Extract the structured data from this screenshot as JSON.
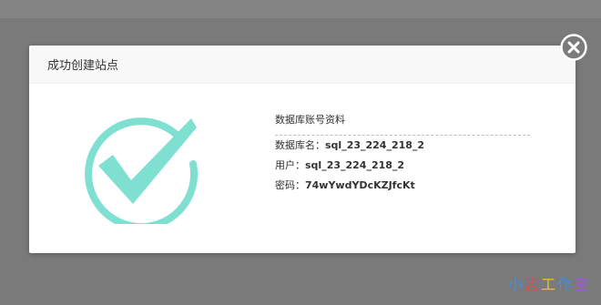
{
  "dialog": {
    "title": "成功创建站点",
    "close_icon": "close-circle-icon",
    "success_icon": "check-circle-icon",
    "colors": {
      "success": "#7fe0d1",
      "overlay": "#7a7a7a",
      "header_bg": "#f8f8f8",
      "close_bg": "#7b7b7b"
    },
    "info": {
      "heading": "数据库账号资料",
      "db_name_label": "数据库名：",
      "db_name_value": "sql_23_224_218_2",
      "user_label": "用户：",
      "user_value": "sql_23_224_218_2",
      "password_label": "密码：",
      "password_value": "74wYwdYDcKZJfcKt"
    }
  },
  "watermark": {
    "chars": [
      "小",
      "志",
      "工",
      "作",
      "室"
    ]
  }
}
